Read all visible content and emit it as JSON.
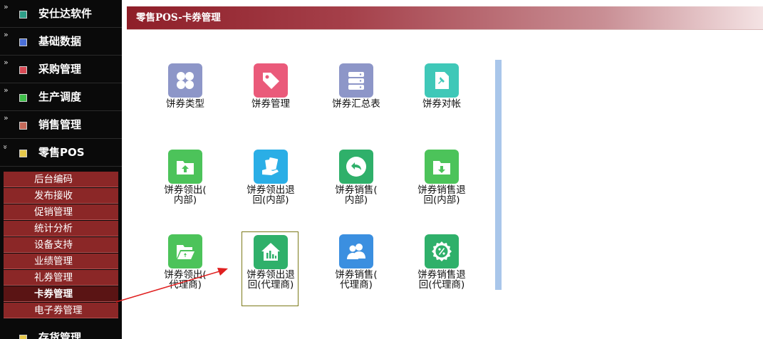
{
  "sidebar": {
    "groups": [
      {
        "label": "安仕达软件",
        "icon_color": "#2e9e88",
        "icon": "company-icon"
      },
      {
        "label": "基础数据",
        "icon_color": "#4a6fd8",
        "icon": "data-icon"
      },
      {
        "label": "采购管理",
        "icon_color": "#d84a55",
        "icon": "purchase-icon"
      },
      {
        "label": "生产调度",
        "icon_color": "#3fbf4a",
        "icon": "production-icon"
      },
      {
        "label": "销售管理",
        "icon_color": "#c46a5a",
        "icon": "sales-icon"
      },
      {
        "label": "零售POS",
        "icon_color": "#e6c84a",
        "icon": "pos-icon"
      }
    ],
    "submenu": [
      {
        "label": "后台编码",
        "active": false
      },
      {
        "label": "发布接收",
        "active": false
      },
      {
        "label": "促销管理",
        "active": false
      },
      {
        "label": "统计分析",
        "active": false
      },
      {
        "label": "设备支持",
        "active": false
      },
      {
        "label": "业绩管理",
        "active": false
      },
      {
        "label": "礼券管理",
        "active": false
      },
      {
        "label": "卡券管理",
        "active": true
      },
      {
        "label": "电子券管理",
        "active": false
      }
    ],
    "bottom_group": {
      "label": "存货管理",
      "icon_color": "#e6c84a",
      "icon": "inventory-icon"
    }
  },
  "header": {
    "title": "零售POS-卡券管理"
  },
  "tiles": [
    {
      "label": "饼券类型",
      "color": "#8d96c8",
      "icon": "grid-four-icon"
    },
    {
      "label": "饼券管理",
      "color": "#ea5a7a",
      "icon": "tag-icon"
    },
    {
      "label": "饼券汇总表",
      "color": "#8d96c8",
      "icon": "server-stack-icon"
    },
    {
      "label": "饼券对帐",
      "color": "#3fc8b8",
      "icon": "pinned-document-icon"
    },
    {
      "label": "饼券领出(\n内部)",
      "color": "#4cc35a",
      "icon": "folder-upload-icon"
    },
    {
      "label": "饼券领出退\n回(内部)",
      "color": "#2aaee6",
      "icon": "tickets-hand-icon"
    },
    {
      "label": "饼券销售(\n内部)",
      "color": "#2fb06a",
      "icon": "undo-circle-icon"
    },
    {
      "label": "饼券销售退\n回(内部)",
      "color": "#4cc35a",
      "icon": "folder-download-icon"
    },
    {
      "label": "饼券领出(\n代理商)",
      "color": "#4cc35a",
      "icon": "folder-open-icon"
    },
    {
      "label": "饼券领出退\n回(代理商)",
      "color": "#2fb06a",
      "icon": "house-chart-icon"
    },
    {
      "label": "饼券销售(\n代理商)",
      "color": "#3b8fe0",
      "icon": "users-icon"
    },
    {
      "label": "饼券销售退\n回(代理商)",
      "color": "#2fb06a",
      "icon": "percent-badge-icon"
    }
  ],
  "selected_tile_index": 9,
  "annotation": {
    "color": "#e02020",
    "icon": "red-arrow-annotation"
  }
}
